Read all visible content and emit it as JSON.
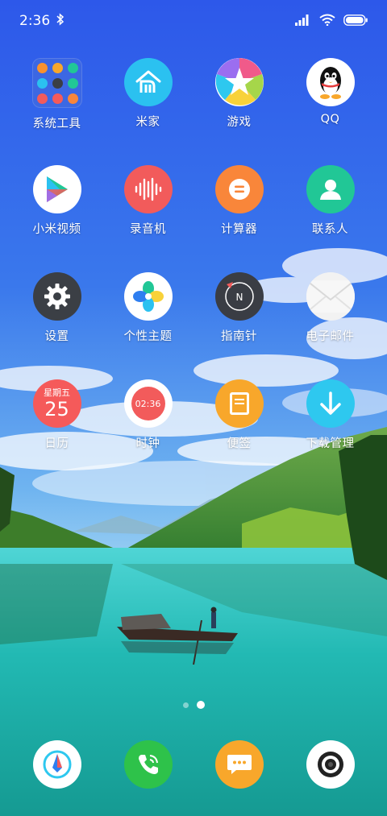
{
  "status_bar": {
    "time": "2:36",
    "icons": [
      "bluetooth-icon",
      "signal-icon",
      "wifi-icon",
      "battery-icon"
    ]
  },
  "apps": [
    {
      "id": "system-tools",
      "label": "系统工具",
      "icon": "folder-icon"
    },
    {
      "id": "mijia",
      "label": "米家",
      "icon": "mi-home-icon",
      "color": "#2bc1f0"
    },
    {
      "id": "games",
      "label": "游戏",
      "icon": "star-icon"
    },
    {
      "id": "qq",
      "label": "QQ",
      "icon": "penguin-icon",
      "color": "#ffffff"
    },
    {
      "id": "mi-video",
      "label": "小米视频",
      "icon": "play-icon",
      "color": "#ffffff"
    },
    {
      "id": "recorder",
      "label": "录音机",
      "icon": "soundwave-icon",
      "color": "#f25b5b"
    },
    {
      "id": "calculator",
      "label": "计算器",
      "icon": "equals-icon",
      "color": "#f9863a"
    },
    {
      "id": "contacts",
      "label": "联系人",
      "icon": "person-icon",
      "color": "#21c796"
    },
    {
      "id": "settings",
      "label": "设置",
      "icon": "gear-icon",
      "color": "#3b3f45"
    },
    {
      "id": "themes",
      "label": "个性主题",
      "icon": "petals-icon",
      "color": "#ffffff"
    },
    {
      "id": "compass",
      "label": "指南针",
      "icon": "compass-icon",
      "color": "#3a3d44"
    },
    {
      "id": "email",
      "label": "电子邮件",
      "icon": "envelope-icon",
      "color": "#f2f2f2"
    },
    {
      "id": "calendar",
      "label": "日历",
      "icon": "calendar-icon",
      "color": "#f55a5a",
      "weekday": "星期五",
      "day": "25"
    },
    {
      "id": "clock",
      "label": "时钟",
      "icon": "clock-icon",
      "color": "#ffffff",
      "time": "02:36"
    },
    {
      "id": "notes",
      "label": "便签",
      "icon": "notebook-icon",
      "color": "#f8a72b"
    },
    {
      "id": "downloads",
      "label": "下载管理",
      "icon": "download-icon",
      "color": "#2ec8ef"
    }
  ],
  "folder_colors": [
    "#f8912e",
    "#f8a72b",
    "#21c796",
    "#2bc1f0",
    "#3b3f45",
    "#21c796",
    "#f25b5b",
    "#f55a5a",
    "#f9863a"
  ],
  "page_indicator": {
    "pages": 2,
    "current": 2
  },
  "dock": [
    {
      "id": "browser",
      "icon": "browser-icon",
      "color": "#ffffff"
    },
    {
      "id": "phone",
      "icon": "phone-icon",
      "color": "#2ec24a"
    },
    {
      "id": "messages",
      "icon": "message-icon",
      "color": "#f8a72b"
    },
    {
      "id": "camera",
      "icon": "camera-icon",
      "color": "#ffffff"
    }
  ]
}
